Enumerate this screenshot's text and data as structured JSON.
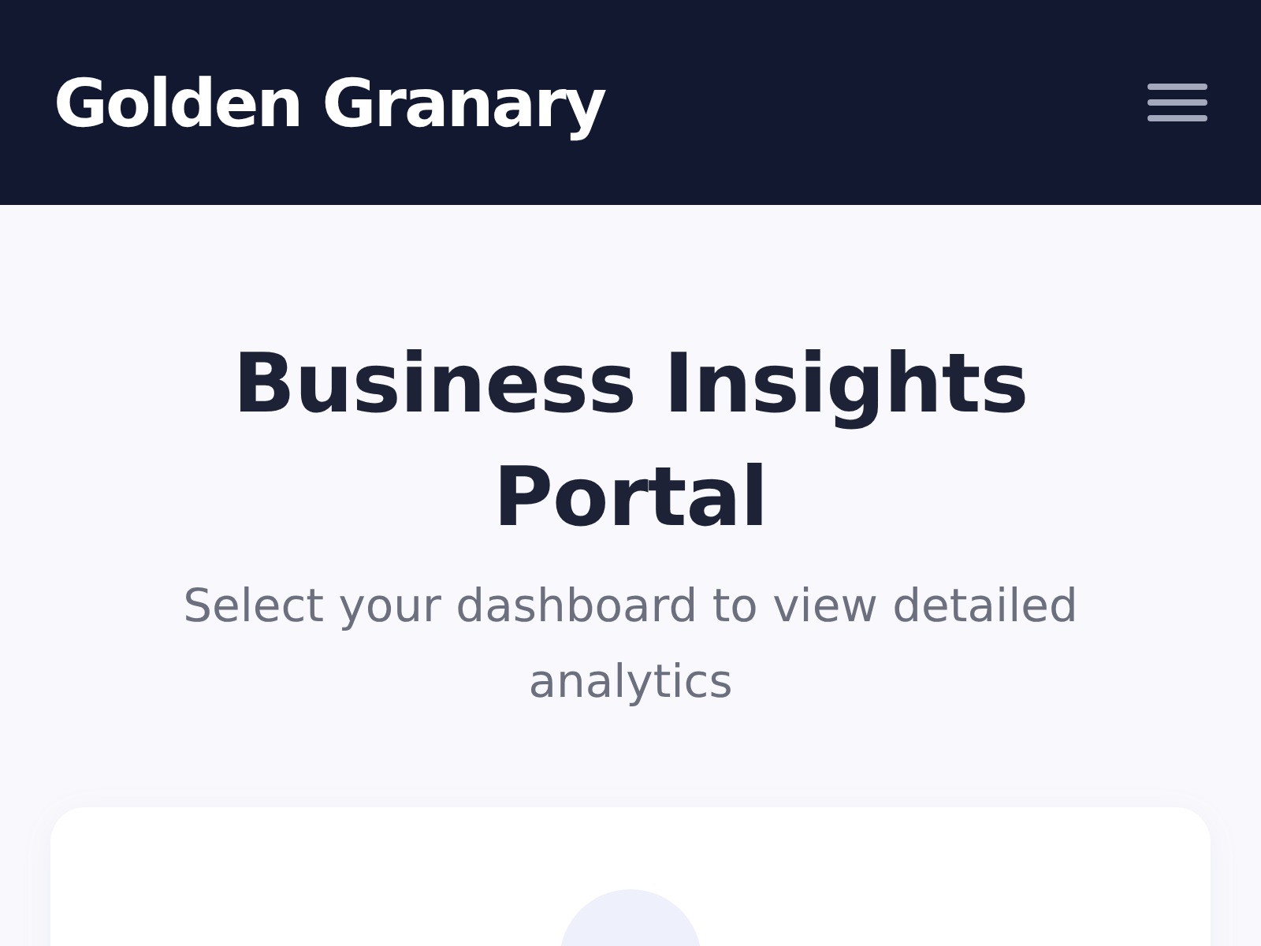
{
  "header": {
    "brand": "Golden Granary"
  },
  "hero": {
    "title": "Business Insights Portal",
    "subtitle": "Select your dashboard to view detailed analytics"
  }
}
